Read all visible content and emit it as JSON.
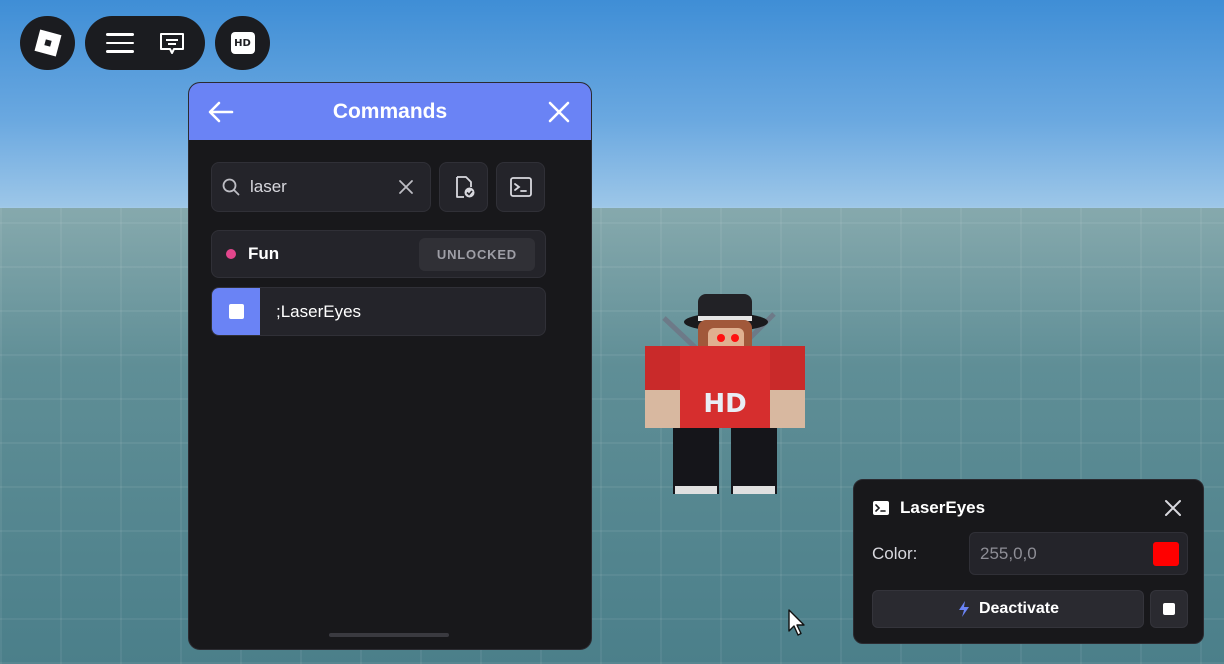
{
  "topbar": {
    "hd_label": "HD"
  },
  "commands_panel": {
    "title": "Commands",
    "search": {
      "value": "laser"
    },
    "category": {
      "label": "Fun",
      "badge": "UNLOCKED"
    },
    "command": {
      "label": ";LaserEyes",
      "checked": true
    }
  },
  "laser_panel": {
    "title": "LaserEyes",
    "color_label": "Color:",
    "color_value": "255,0,0",
    "swatch_color": "#ff0000",
    "deactivate_label": "Deactivate"
  },
  "colors": {
    "accent": "#6a83f5",
    "category_dot": "#e2468c",
    "panel_bg": "#18181b"
  },
  "character": {
    "shirt_text": "HD"
  }
}
